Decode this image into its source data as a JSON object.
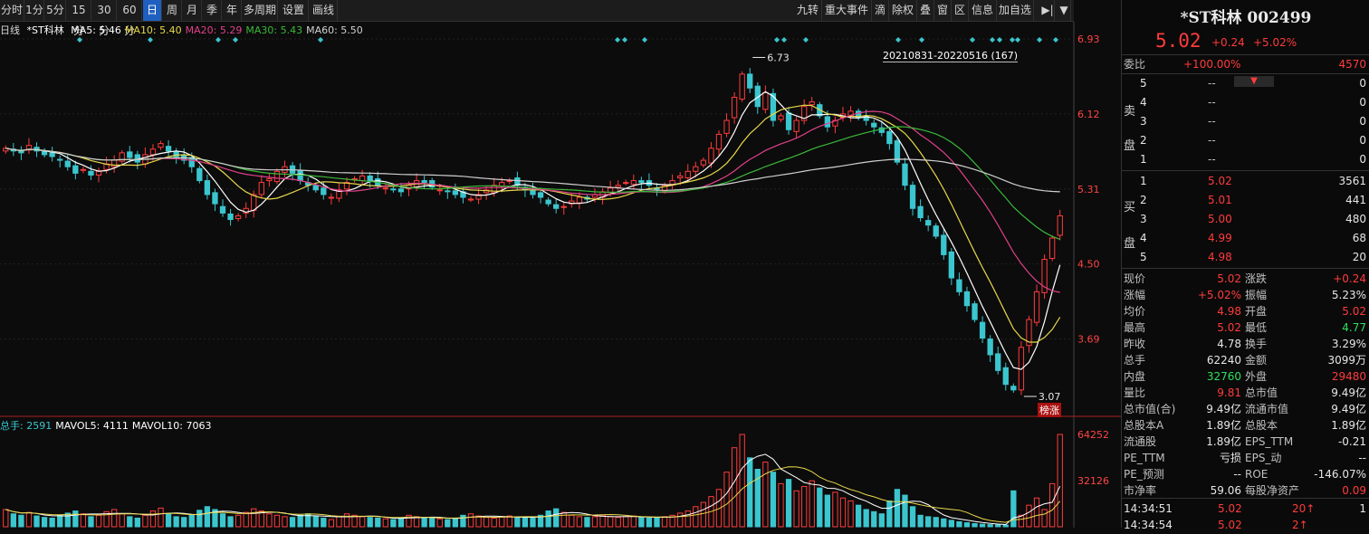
{
  "toolbar": {
    "left_items": [
      "分时",
      "1分",
      "5分",
      "15分",
      "30分",
      "60分",
      "日",
      "周",
      "月",
      "季",
      "年",
      "多周期",
      "设置",
      "画线"
    ],
    "active_item": "日",
    "right_items": [
      "九转",
      "重大事件",
      "滴",
      "除权",
      "叠",
      "窗",
      "区",
      "信息",
      "加自选"
    ]
  },
  "ma_legend": {
    "period": "日线",
    "name": "*ST科林",
    "items": [
      {
        "text": "MA5: 5.46",
        "color": "#ffffff"
      },
      {
        "text": "MA10: 5.40",
        "color": "#e8d84a"
      },
      {
        "text": "MA20: 5.29",
        "color": "#e0408a"
      },
      {
        "text": "MA30: 5.43",
        "color": "#3ab83a"
      },
      {
        "text": "MA60: 5.50",
        "color": "#d0d0d0"
      }
    ]
  },
  "range_label": "20210831-20220516 (167)",
  "bang_tag": "榜涨",
  "vol_legend": {
    "items": [
      {
        "text": "总手: 2591",
        "color": "#3bc6cf"
      },
      {
        "text": "MAVOL5: 4111",
        "color": "#ffffff"
      },
      {
        "text": "MAVOL10: 7063",
        "color": "#ffffff"
      }
    ]
  },
  "chart_data": {
    "type": "candlestick",
    "price_axis_ticks": [
      "6.93",
      "6.12",
      "5.31",
      "4.50",
      "3.69"
    ],
    "volume_axis_ticks": [
      "64252",
      "32126"
    ],
    "ylim": [
      3.07,
      6.93
    ],
    "ma_periods": [
      5,
      10,
      20,
      30,
      60
    ],
    "ma_colors": [
      "#ffffff",
      "#e8d84a",
      "#e0408a",
      "#3ab83a",
      "#d0d0d0"
    ],
    "annotations": [
      {
        "text": "6.73",
        "value": 6.73
      },
      {
        "text": "3.07",
        "value": 3.07
      }
    ],
    "closes": [
      5.75,
      5.72,
      5.7,
      5.78,
      5.72,
      5.68,
      5.66,
      5.62,
      5.55,
      5.48,
      5.52,
      5.46,
      5.5,
      5.58,
      5.62,
      5.7,
      5.65,
      5.6,
      5.68,
      5.74,
      5.8,
      5.72,
      5.66,
      5.62,
      5.55,
      5.4,
      5.25,
      5.15,
      5.05,
      4.98,
      5.02,
      5.1,
      5.25,
      5.38,
      5.42,
      5.5,
      5.55,
      5.48,
      5.4,
      5.35,
      5.3,
      5.25,
      5.22,
      5.3,
      5.38,
      5.42,
      5.45,
      5.4,
      5.35,
      5.32,
      5.3,
      5.28,
      5.35,
      5.4,
      5.38,
      5.33,
      5.3,
      5.28,
      5.25,
      5.22,
      5.2,
      5.25,
      5.3,
      5.35,
      5.38,
      5.4,
      5.35,
      5.3,
      5.25,
      5.22,
      5.15,
      5.1,
      5.12,
      5.18,
      5.22,
      5.2,
      5.25,
      5.28,
      5.32,
      5.35,
      5.38,
      5.4,
      5.38,
      5.35,
      5.3,
      5.35,
      5.4,
      5.45,
      5.5,
      5.55,
      5.62,
      5.75,
      5.9,
      6.05,
      6.3,
      6.55,
      6.4,
      6.2,
      6.35,
      6.05,
      6.1,
      5.95,
      6.05,
      6.2,
      6.25,
      6.1,
      5.98,
      6.05,
      6.12,
      6.15,
      6.08,
      6.05,
      5.98,
      5.92,
      5.8,
      5.6,
      5.35,
      5.1,
      5.0,
      4.92,
      4.8,
      4.6,
      4.35,
      4.2,
      4.05,
      3.9,
      3.7,
      3.52,
      3.35,
      3.2,
      3.14,
      3.6,
      3.9,
      4.2,
      4.55,
      4.78,
      5.02
    ],
    "volumes": [
      12000,
      9000,
      8000,
      10000,
      7500,
      6500,
      6000,
      8000,
      9500,
      11000,
      9000,
      7000,
      8000,
      10500,
      12000,
      9000,
      7000,
      6000,
      8000,
      11000,
      13000,
      9000,
      7000,
      6500,
      8000,
      11500,
      14000,
      12000,
      9000,
      7000,
      8000,
      10000,
      12500,
      11000,
      9000,
      8000,
      7000,
      6500,
      8000,
      9000,
      7500,
      6000,
      5000,
      7000,
      9000,
      8000,
      7000,
      6500,
      6000,
      5500,
      5000,
      6000,
      8000,
      7000,
      6500,
      6000,
      5500,
      5000,
      6000,
      8000,
      9000,
      7500,
      6500,
      6000,
      7000,
      7500,
      6500,
      6000,
      6000,
      8000,
      11000,
      12500,
      10000,
      8000,
      7000,
      6500,
      7000,
      8000,
      7000,
      6500,
      7000,
      7500,
      6500,
      6000,
      6000,
      7000,
      8000,
      9500,
      11000,
      14000,
      17000,
      21000,
      26000,
      38000,
      55000,
      64252,
      48000,
      40000,
      45000,
      38000,
      30000,
      33000,
      25000,
      28000,
      32000,
      27000,
      22000,
      24000,
      20000,
      18000,
      15000,
      12000,
      10500,
      9000,
      18000,
      26000,
      22000,
      14000,
      8000,
      7000,
      6500,
      5500,
      4500,
      3500,
      2800,
      2200,
      1800,
      1500,
      1300,
      1200,
      25000,
      8000,
      15000,
      20000,
      12000,
      30000,
      64252
    ]
  },
  "panel": {
    "title": "*ST科林 002499",
    "price": "5.02",
    "change": "+0.24",
    "change_pct": "+5.02%",
    "weibi_label": "委比",
    "weibi_pct": "+100.00%",
    "weibi_diff": "4570",
    "sell_side_label": "卖盘",
    "buy_side_label": "买盘",
    "sells": [
      {
        "level": "5",
        "price": "--",
        "vol": "0"
      },
      {
        "level": "4",
        "price": "--",
        "vol": "0"
      },
      {
        "level": "3",
        "price": "--",
        "vol": "0"
      },
      {
        "level": "2",
        "price": "--",
        "vol": "0"
      },
      {
        "level": "1",
        "price": "--",
        "vol": "0"
      }
    ],
    "buys": [
      {
        "level": "1",
        "price": "5.02",
        "vol": "3561"
      },
      {
        "level": "2",
        "price": "5.01",
        "vol": "441"
      },
      {
        "level": "3",
        "price": "5.00",
        "vol": "480"
      },
      {
        "level": "4",
        "price": "4.99",
        "vol": "68"
      },
      {
        "level": "5",
        "price": "4.98",
        "vol": "20"
      }
    ],
    "stats": [
      {
        "l": "现价",
        "lv": "5.02",
        "lc": "red",
        "r": "涨跌",
        "rv": "+0.24",
        "rc": "red"
      },
      {
        "l": "涨幅",
        "lv": "+5.02%",
        "lc": "red",
        "r": "振幅",
        "rv": "5.23%",
        "rc": "white"
      },
      {
        "l": "均价",
        "lv": "4.98",
        "lc": "red",
        "r": "开盘",
        "rv": "5.02",
        "rc": "red"
      },
      {
        "l": "最高",
        "lv": "5.02",
        "lc": "red",
        "r": "最低",
        "rv": "4.77",
        "rc": "green"
      },
      {
        "l": "昨收",
        "lv": "4.78",
        "lc": "white",
        "r": "换手",
        "rv": "3.29%",
        "rc": "white"
      },
      {
        "l": "总手",
        "lv": "62240",
        "lc": "white",
        "r": "金额",
        "rv": "3099万",
        "rc": "white"
      },
      {
        "l": "内盘",
        "lv": "32760",
        "lc": "green",
        "r": "外盘",
        "rv": "29480",
        "rc": "red"
      },
      {
        "l": "量比",
        "lv": "9.81",
        "lc": "red",
        "r": "总市值",
        "rv": "9.49亿",
        "rc": "white"
      },
      {
        "l": "总市值(合)",
        "lv": "9.49亿",
        "lc": "white",
        "r": "流通市值",
        "rv": "9.49亿",
        "rc": "white"
      },
      {
        "l": "总股本A",
        "lv": "1.89亿",
        "lc": "white",
        "r": "总股本",
        "rv": "1.89亿",
        "rc": "white"
      },
      {
        "l": "流通股",
        "lv": "1.89亿",
        "lc": "white",
        "r": "EPS_TTM",
        "rv": "-0.21",
        "rc": "white"
      },
      {
        "l": "PE_TTM",
        "lv": "亏损",
        "lc": "white",
        "r": "EPS_动",
        "rv": "--",
        "rc": "white"
      },
      {
        "l": "PE_预测",
        "lv": "--",
        "lc": "white",
        "r": "ROE",
        "rv": "-146.07%",
        "rc": "white"
      },
      {
        "l": "市净率",
        "lv": "59.06",
        "lc": "white",
        "r": "每股净资产",
        "rv": "0.09",
        "rc": "red"
      }
    ],
    "ticks": [
      {
        "time": "14:34:51",
        "price": "5.02",
        "vol": "20",
        "flag": "1"
      },
      {
        "time": "14:34:54",
        "price": "5.02",
        "vol": "2",
        "flag": ""
      }
    ]
  }
}
